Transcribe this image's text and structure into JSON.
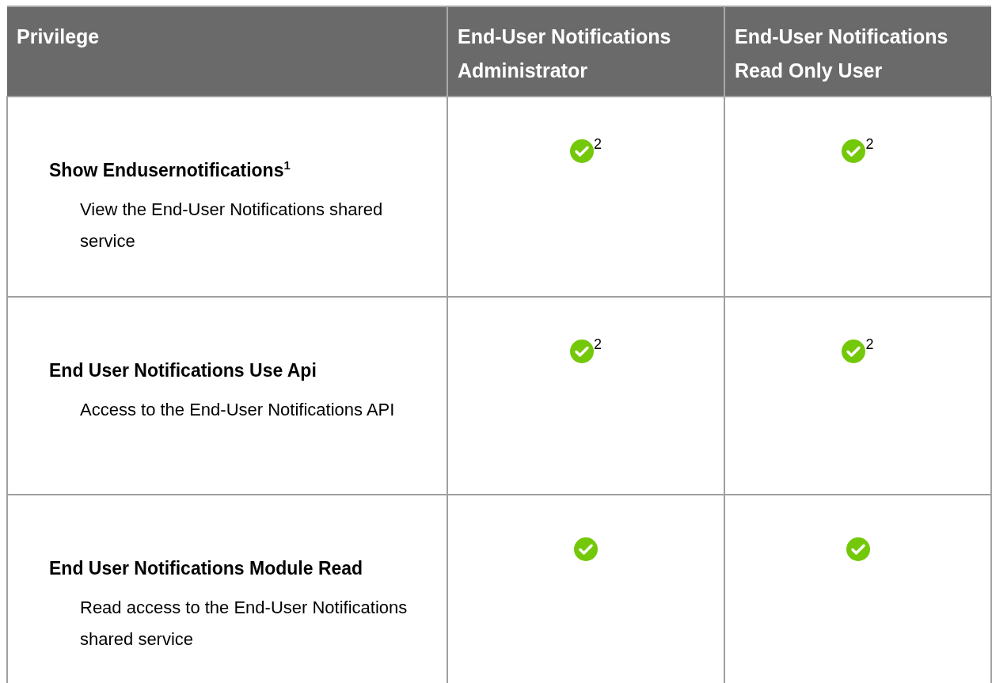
{
  "table": {
    "columns": [
      "Privilege",
      "End-User Notifications Administrator",
      "End-User Notifications Read Only User"
    ],
    "rows": [
      {
        "cells": [
          {
            "kind": "privilege",
            "name": "Show Endusernotifications$^{1}$",
            "description": "View the End-User Notifications shared service"
          },
          {
            "kind": "check",
            "granted": true,
            "note": "2"
          },
          {
            "kind": "check",
            "granted": true,
            "note": "2"
          }
        ]
      },
      {
        "cells": [
          {
            "kind": "privilege",
            "name": "End User Notifications Use Api",
            "description": "Access to the End-User Notifications API"
          },
          {
            "kind": "check",
            "granted": true,
            "note": "2"
          },
          {
            "kind": "check",
            "granted": true,
            "note": "2"
          }
        ]
      },
      {
        "cells": [
          {
            "kind": "privilege",
            "name": "End User Notifications Module Read",
            "description": "Read access to the End-User Notifications shared service"
          },
          {
            "kind": "check",
            "granted": true
          },
          {
            "kind": "check",
            "granted": true
          }
        ]
      }
    ]
  }
}
